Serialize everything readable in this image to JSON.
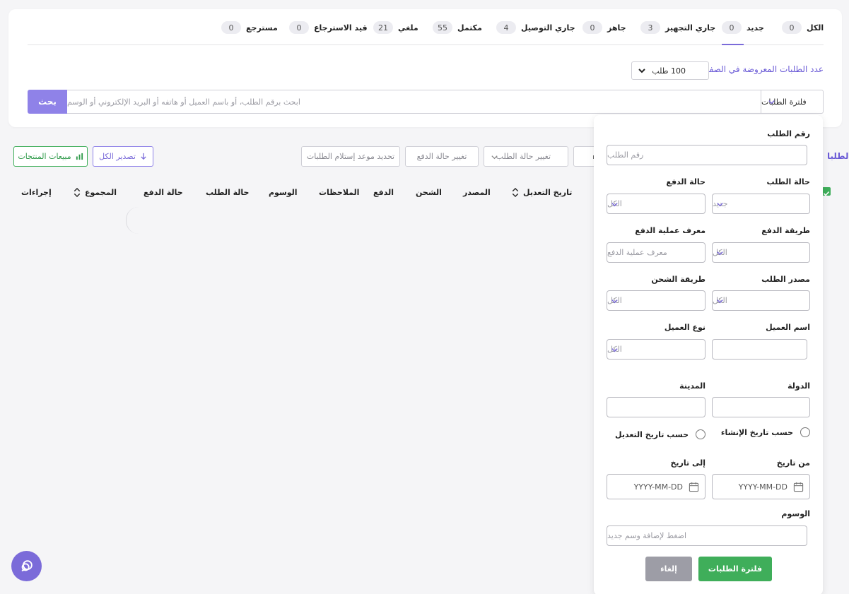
{
  "tabs": [
    {
      "label": "الكل",
      "count": "0"
    },
    {
      "label": "جديد",
      "count": "0"
    },
    {
      "label": "جاري التجهيز",
      "count": "3"
    },
    {
      "label": "جاهز",
      "count": "0"
    },
    {
      "label": "جاري التوصيل",
      "count": "4"
    },
    {
      "label": "مكتمل",
      "count": "55"
    },
    {
      "label": "ملغي",
      "count": "21"
    },
    {
      "label": "قيد الاسترجاع",
      "count": "0"
    },
    {
      "label": "مسترجع",
      "count": "0"
    }
  ],
  "perpage": {
    "label": "عدد الطلبات المعروضة في الصفحة",
    "value": "100 طلب"
  },
  "search": {
    "button": "بحث",
    "placeholder": "ابحث برقم الطلب، أو باسم العميل أو هاتفه أو البريد الإلكتروني أو الوسم",
    "filter_toggle": "فلترة الطلبات"
  },
  "toolbar": {
    "orders_label_cut": "الطلبا",
    "change_order_status": "تغيير حالة الطلب",
    "change_payment_status": "تغيير حالة الدفع",
    "set_pickup": "تحديد موعد إستلام الطلبات",
    "export_all": "تصدير الكل",
    "product_sales": "مبيعات المنتجات"
  },
  "table": {
    "headers": {
      "modified_date": "تاريخ التعديل",
      "source": "المصدر",
      "shipping": "الشحن",
      "payment": "الدفع",
      "notes": "الملاحظات",
      "tags": "الوسوم",
      "order_status": "حالة الطلب",
      "payment_status": "حالة الدفع",
      "total": "المجموع",
      "actions": "إجراءات"
    }
  },
  "filter_panel": {
    "order_number": {
      "label": "رقم الطلب",
      "placeholder": "رقم الطلب"
    },
    "order_status": {
      "label": "حالة الطلب",
      "value": "جديد"
    },
    "payment_status": {
      "label": "حالة الدفع",
      "value": "الكل"
    },
    "payment_method": {
      "label": "طريقة الدفع",
      "value": "الكل"
    },
    "transaction_id": {
      "label": "معرف عملية الدفع",
      "placeholder": "معرف عملية الدفع"
    },
    "order_source": {
      "label": "مصدر الطلب",
      "value": "الكل"
    },
    "shipping_method": {
      "label": "طريقة الشحن",
      "value": "الكل"
    },
    "customer_name": {
      "label": "اسم العميل",
      "value": ""
    },
    "customer_type": {
      "label": "نوع العميل",
      "value": "الكل"
    },
    "country": {
      "label": "الدولة",
      "value": ""
    },
    "city": {
      "label": "المدينة",
      "value": ""
    },
    "by_created": "حسب تاريخ الإنشاء",
    "by_modified": "حسب تاريخ التعديل",
    "from_date": {
      "label": "من تاريخ",
      "placeholder": "YYYY-MM-DD"
    },
    "to_date": {
      "label": "إلى تاريخ",
      "placeholder": "YYYY-MM-DD"
    },
    "tags": {
      "label": "الوسوم",
      "placeholder": "اضغط لإضافة وسم جديد"
    },
    "apply": "فلترة الطلبات",
    "cancel": "إلغاء"
  },
  "colors": {
    "accent": "#7b6bd9",
    "success": "#3fae5a",
    "muted": "#9d9da6"
  }
}
